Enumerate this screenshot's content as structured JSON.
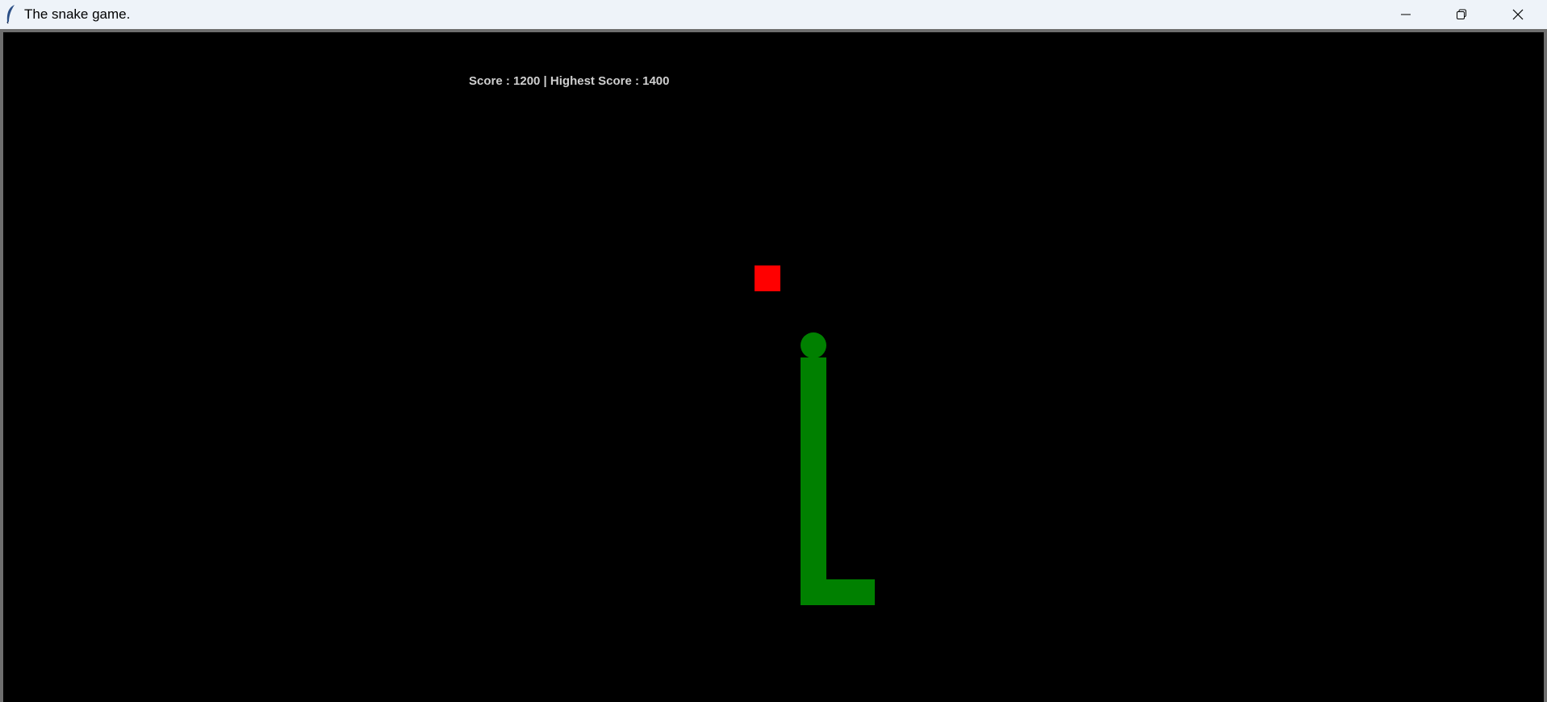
{
  "window": {
    "title": "The snake game.",
    "icon": "feather-icon",
    "controls": [
      "minimize-icon",
      "restore-icon",
      "close-icon"
    ]
  },
  "game": {
    "score_text": "Score : 1200 | Highest Score : 1400",
    "score": 1200,
    "highest_score": 1400,
    "colors": {
      "background": "#000000",
      "snake": "#008000",
      "food": "#ff0000",
      "score_text": "#cfcfcf"
    }
  }
}
